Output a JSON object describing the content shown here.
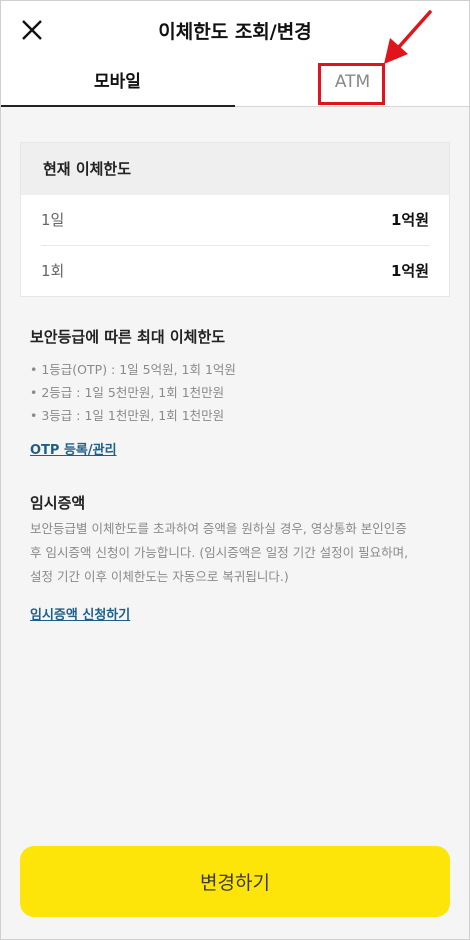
{
  "header": {
    "title": "이체한도 조회/변경"
  },
  "tabs": [
    {
      "label": "모바일",
      "active": true
    },
    {
      "label": "ATM",
      "active": false
    }
  ],
  "current_limit": {
    "title": "현재 이체한도",
    "rows": [
      {
        "label": "1일",
        "value": "1억원"
      },
      {
        "label": "1회",
        "value": "1억원"
      }
    ]
  },
  "security": {
    "title": "보안등급에 따른 최대 이체한도",
    "items": [
      "• 1등급(OTP) : 1일 5억원, 1회 1억원",
      "• 2등급 : 1일 5천만원, 1회 1천만원",
      "• 3등급 : 1일 1천만원, 1회 1천만원"
    ],
    "link": "OTP 등록/관리"
  },
  "temp_increase": {
    "title": "임시증액",
    "description_lines": [
      "보안등급별 이체한도를 초과하여 증액을 원하실 경우, 영상통화 본인인증",
      "후 임시증액 신청이 가능합니다. (임시증액은 일정 기간 설정이 필요하며,",
      "설정 기간 이후 이체한도는 자동으로 복귀됩니다.)"
    ],
    "link": "임시증액 신청하기"
  },
  "footer": {
    "button_label": "변경하기"
  },
  "colors": {
    "accent_yellow": "#fde409",
    "highlight_red": "#e0141b",
    "link_blue": "#1f5f87"
  }
}
